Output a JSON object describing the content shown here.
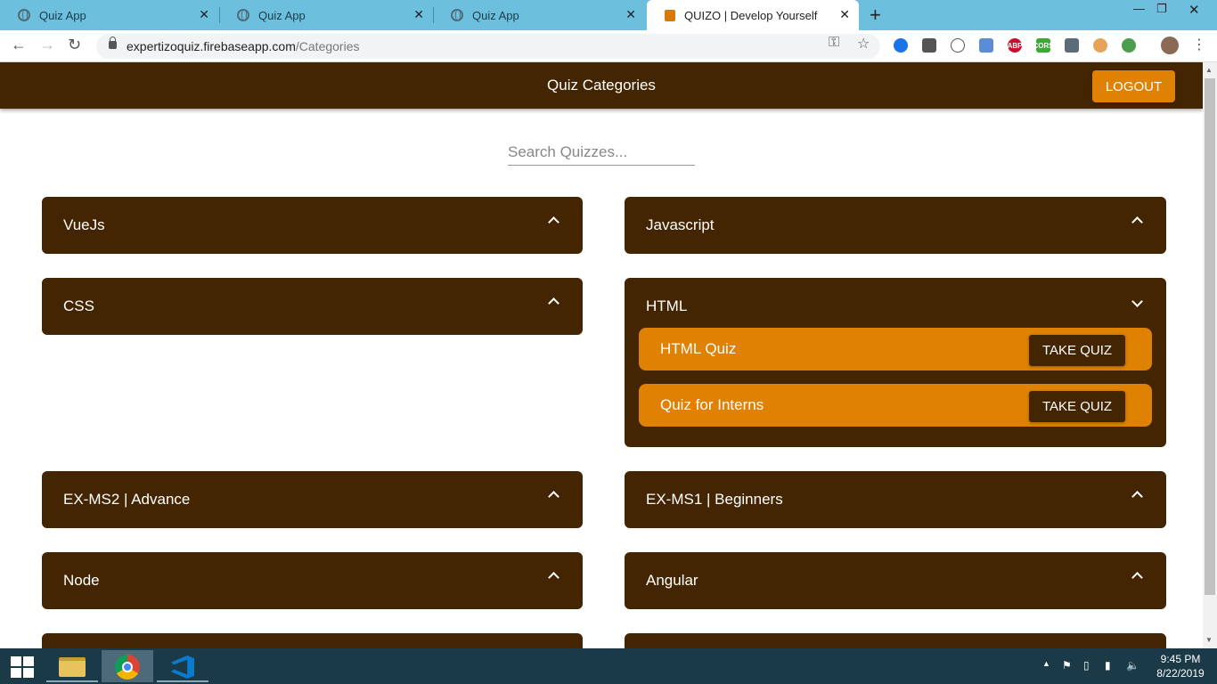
{
  "browser": {
    "tabs": [
      {
        "title": "Quiz App",
        "active": false
      },
      {
        "title": "Quiz App",
        "active": false
      },
      {
        "title": "Quiz App",
        "active": false
      },
      {
        "title": "QUIZO | Develop Yourself",
        "active": true
      }
    ],
    "url_host": "expertizoquiz.firebaseapp.com",
    "url_path": "/Categories"
  },
  "header": {
    "title": "Quiz Categories",
    "logout_label": "LOGOUT"
  },
  "search": {
    "placeholder": "Search Quizzes..."
  },
  "categories": [
    {
      "name": "VueJs",
      "expanded": false
    },
    {
      "name": "Javascript",
      "expanded": false
    },
    {
      "name": "CSS",
      "expanded": false
    },
    {
      "name": "HTML",
      "expanded": true,
      "quizzes": [
        {
          "name": "HTML Quiz",
          "action": "TAKE QUIZ"
        },
        {
          "name": "Quiz for Interns",
          "action": "TAKE QUIZ"
        }
      ]
    },
    {
      "name": "EX-MS2 | Advance",
      "expanded": false
    },
    {
      "name": "EX-MS1 | Beginners",
      "expanded": false
    },
    {
      "name": "Node",
      "expanded": false
    },
    {
      "name": "Angular",
      "expanded": false
    }
  ],
  "taskbar": {
    "time": "9:45 PM",
    "date": "8/22/2019"
  },
  "colors": {
    "header_bg": "#442502",
    "accent": "#df8103",
    "tabbar": "#6cc0de",
    "taskbar": "#1b3a48"
  }
}
